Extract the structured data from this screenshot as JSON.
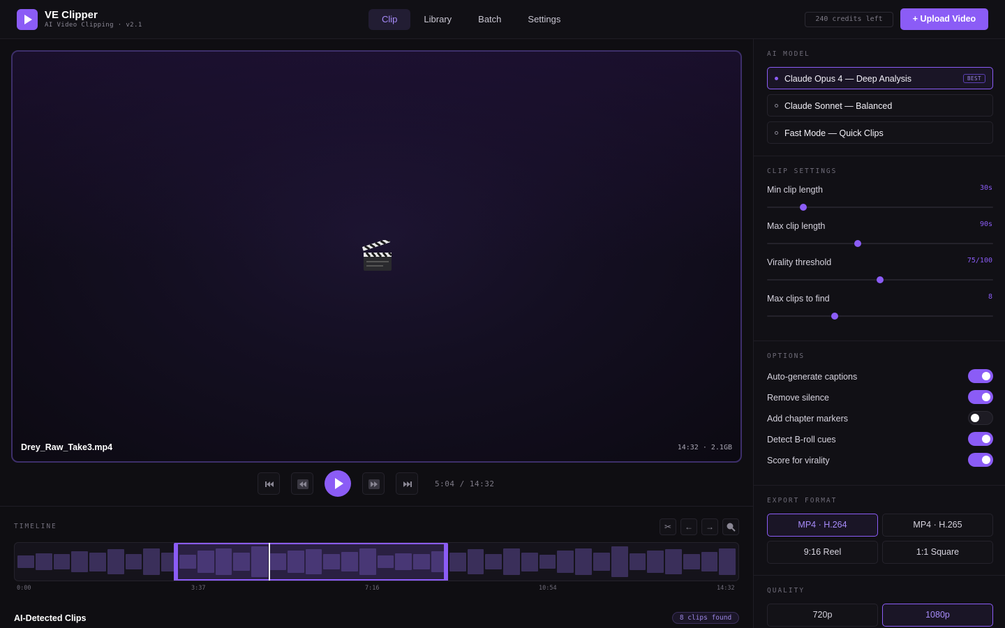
{
  "header": {
    "app_title": "VE Clipper",
    "app_subtitle": "AI Video Clipping · v2.1",
    "tabs": [
      {
        "label": "Clip",
        "active": true
      },
      {
        "label": "Library",
        "active": false
      },
      {
        "label": "Batch",
        "active": false
      },
      {
        "label": "Settings",
        "active": false
      }
    ],
    "credits": "240 credits left",
    "upload_label": "+ Upload Video"
  },
  "player": {
    "file_name": "Drey_Raw_Take3.mp4",
    "file_meta": "14:32 · 2.1GB",
    "placeholder_icon": "clapperboard-icon",
    "time_readout": "5:04 / 14:32"
  },
  "timeline": {
    "label": "TIMELINE",
    "ticks": [
      "0:00",
      "3:37",
      "7:16",
      "10:54",
      "14:32"
    ],
    "selection": {
      "start": "3:37",
      "end": "9:47",
      "playhead": "5:04"
    },
    "tools": [
      "scissors-icon",
      "arrow-left-icon",
      "arrow-right-icon",
      "zoom-icon"
    ]
  },
  "clips": {
    "title": "AI-Detected Clips",
    "count_badge": "8 clips found"
  },
  "sidebar": {
    "model_label": "AI MODEL",
    "models": [
      {
        "name": "Claude Opus 4 — Deep Analysis",
        "badge": "BEST",
        "selected": true
      },
      {
        "name": "Claude Sonnet — Balanced",
        "selected": false
      },
      {
        "name": "Fast Mode — Quick Clips",
        "selected": false
      }
    ],
    "clip_settings_label": "CLIP SETTINGS",
    "sliders": [
      {
        "label": "Min clip length",
        "value": "30s",
        "fraction": 0.16
      },
      {
        "label": "Max clip length",
        "value": "90s",
        "fraction": 0.4
      },
      {
        "label": "Virality threshold",
        "value": "75/100",
        "fraction": 0.5
      },
      {
        "label": "Max clips to find",
        "value": "8",
        "fraction": 0.3
      }
    ],
    "options_label": "OPTIONS",
    "options": [
      {
        "label": "Auto-generate captions",
        "on": true
      },
      {
        "label": "Remove silence",
        "on": true
      },
      {
        "label": "Add chapter markers",
        "on": false
      },
      {
        "label": "Detect B-roll cues",
        "on": true
      },
      {
        "label": "Score for virality",
        "on": true
      }
    ],
    "export_label": "EXPORT FORMAT",
    "formats": [
      {
        "label": "MP4 · H.264",
        "selected": true
      },
      {
        "label": "MP4 · H.265",
        "selected": false
      },
      {
        "label": "9:16 Reel",
        "selected": false
      },
      {
        "label": "1:1 Square",
        "selected": false
      }
    ],
    "quality_label": "QUALITY",
    "qualities": [
      {
        "label": "720p",
        "selected": false
      },
      {
        "label": "1080p",
        "selected": true
      }
    ]
  },
  "colors": {
    "accent": "#8b5cf6",
    "background": "#0f0e12",
    "panel": "#111015"
  }
}
